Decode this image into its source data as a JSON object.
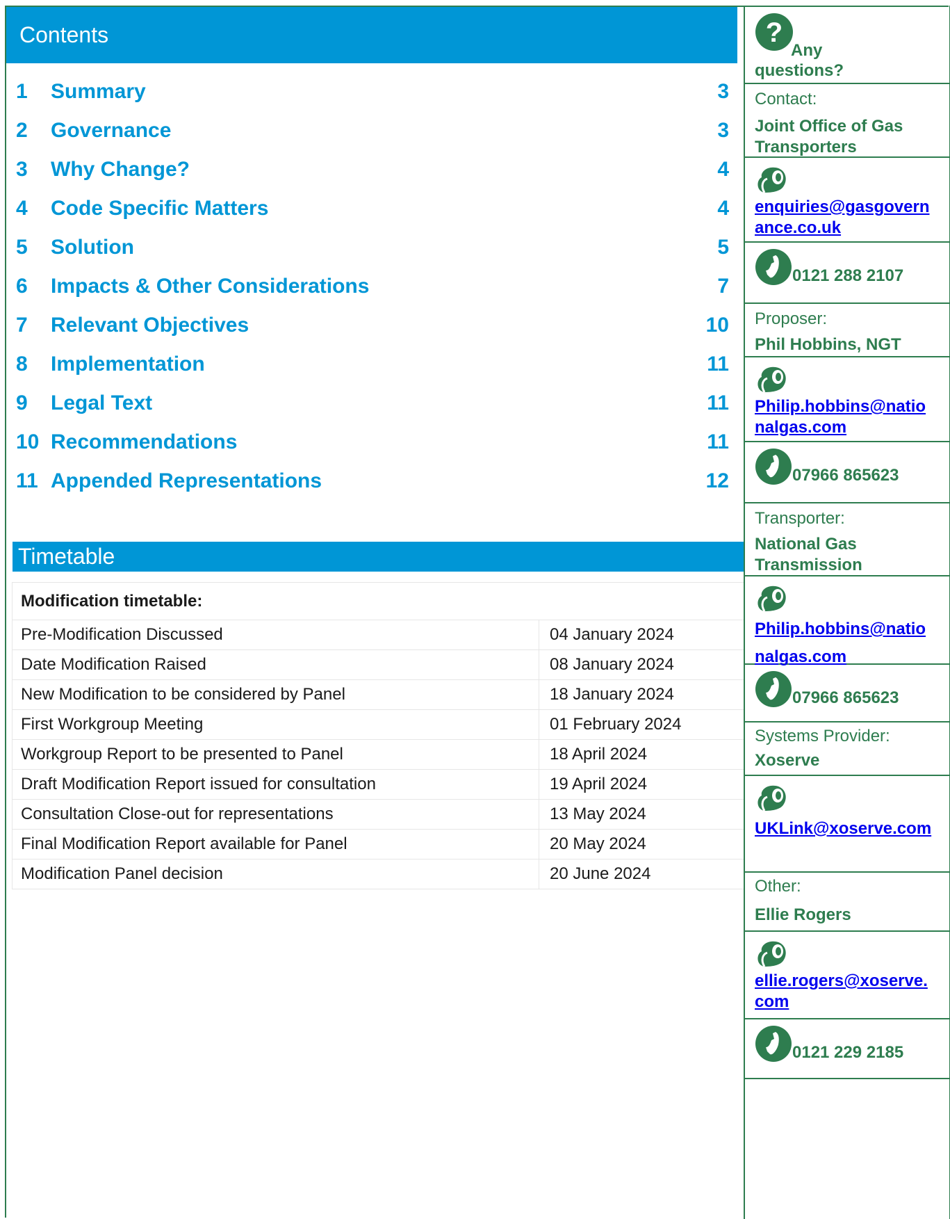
{
  "contents": {
    "title": "Contents",
    "items": [
      {
        "num": "1",
        "title": "Summary",
        "page": "3"
      },
      {
        "num": "2",
        "title": "Governance",
        "page": "3"
      },
      {
        "num": "3",
        "title": "Why Change?",
        "page": "4"
      },
      {
        "num": "4",
        "title": "Code Specific Matters",
        "page": "4"
      },
      {
        "num": "5",
        "title": "Solution",
        "page": "5"
      },
      {
        "num": "6",
        "title": "Impacts & Other Considerations",
        "page": "7"
      },
      {
        "num": "7",
        "title": "Relevant Objectives",
        "page": "10"
      },
      {
        "num": "8",
        "title": "Implementation",
        "page": "11"
      },
      {
        "num": "9",
        "title": "Legal Text",
        "page": "11"
      },
      {
        "num": "10",
        "title": "Recommendations",
        "page": "11"
      },
      {
        "num": "11",
        "title": "Appended Representations",
        "page": "12"
      }
    ]
  },
  "timetable": {
    "title": "Timetable",
    "heading": "Modification timetable:",
    "rows": [
      {
        "event": "Pre-Modification Discussed",
        "date": "04 January 2024"
      },
      {
        "event": "Date Modification Raised",
        "date": "08 January 2024"
      },
      {
        "event": "New Modification to be considered by Panel",
        "date": "18 January 2024"
      },
      {
        "event": "First Workgroup Meeting",
        "date": "01 February 2024"
      },
      {
        "event": "Workgroup Report to be presented to Panel",
        "date": "18 April 2024"
      },
      {
        "event": "Draft Modification Report issued for consultation",
        "date": "19 April 2024"
      },
      {
        "event": "Consultation Close-out for representations",
        "date": "13 May 2024"
      },
      {
        "event": "Final Modification Report available for Panel",
        "date": "20 May 2024"
      },
      {
        "event": "Modification Panel decision",
        "date": "20 June 2024"
      }
    ]
  },
  "sidebar": {
    "questions_label": "Any questions?",
    "contact": {
      "label": "Contact:",
      "name": "Joint Office of Gas Transporters",
      "email": "enquiries@gasgovernance.co.uk",
      "phone": "0121 288 2107"
    },
    "proposer": {
      "label": "Proposer:",
      "name": "Phil Hobbins, NGT",
      "email": "Philip.hobbins@nationalgas.com",
      "phone": "07966 865623"
    },
    "transporter": {
      "label": "Transporter:",
      "name": "National Gas Transmission",
      "email": "Philip.hobbins@nationalgas.com",
      "phone": "07966 865623"
    },
    "systems_provider": {
      "label": "Systems Provider:",
      "name": "Xoserve",
      "email": "UKLink@xoserve.com"
    },
    "other": {
      "label": "Other:",
      "name": "Ellie Rogers",
      "email": "ellie.rogers@xoserve.com",
      "phone": "0121 229 2185"
    }
  },
  "colors": {
    "accent": "#0096d6",
    "border_green": "#2e7d4f",
    "link": "#0000ee"
  }
}
